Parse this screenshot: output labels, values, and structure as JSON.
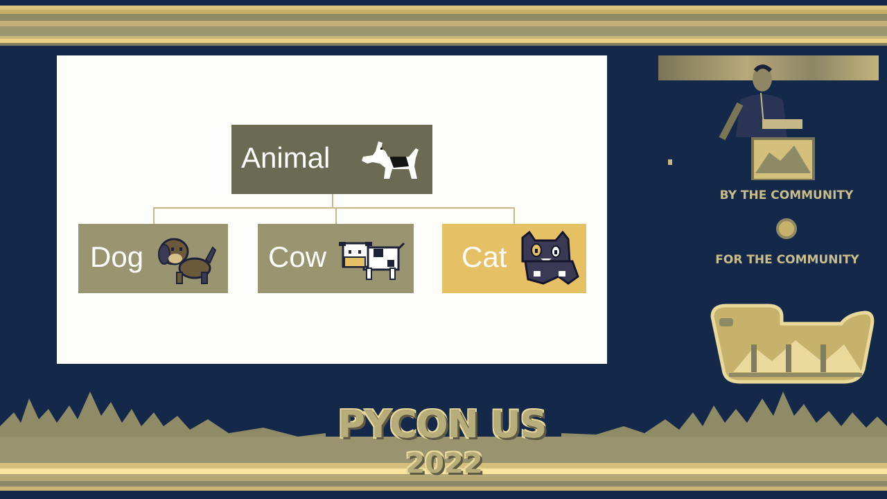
{
  "slide": {
    "root": {
      "label": "Animal",
      "icon": "dog-silhouette-icon"
    },
    "children": [
      {
        "label": "Dog",
        "icon": "puppy-icon"
      },
      {
        "label": "Cow",
        "icon": "cow-icon"
      },
      {
        "label": "Cat",
        "icon": "cat-icon"
      }
    ]
  },
  "side_panel": {
    "tagline_top": "BY THE COMMUNITY",
    "tagline_bottom": "FOR THE COMMUNITY"
  },
  "branding": {
    "event_name": "PYCON US",
    "event_year": "2022"
  },
  "colors": {
    "background": "#14284a",
    "root_box": "#6b6b54",
    "child_box": "#999570",
    "highlight_box": "#e6c065",
    "accent_gold": "#c9bd8a"
  }
}
